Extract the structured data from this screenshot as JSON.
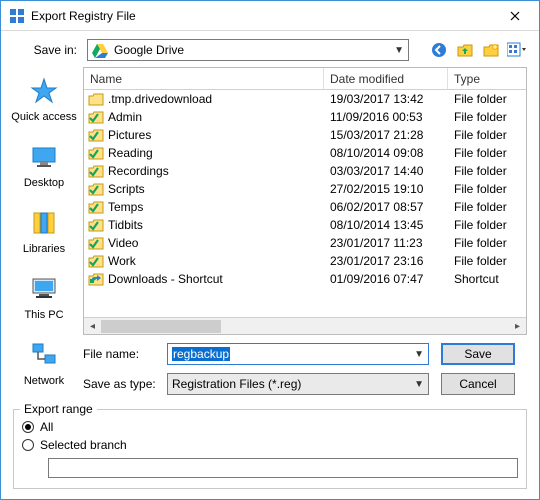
{
  "window": {
    "title": "Export Registry File"
  },
  "savein": {
    "label": "Save in:",
    "value": "Google Drive"
  },
  "places": [
    {
      "key": "quick",
      "label": "Quick access"
    },
    {
      "key": "desktop",
      "label": "Desktop"
    },
    {
      "key": "libraries",
      "label": "Libraries"
    },
    {
      "key": "thispc",
      "label": "This PC"
    },
    {
      "key": "network",
      "label": "Network"
    }
  ],
  "columns": {
    "name": "Name",
    "date": "Date modified",
    "type": "Type"
  },
  "files": [
    {
      "name": ".tmp.drivedownload",
      "date": "19/03/2017 13:42",
      "type": "File folder",
      "icon": "folder"
    },
    {
      "name": "Admin",
      "date": "11/09/2016 00:53",
      "type": "File folder",
      "icon": "folder-check"
    },
    {
      "name": "Pictures",
      "date": "15/03/2017 21:28",
      "type": "File folder",
      "icon": "folder-check"
    },
    {
      "name": "Reading",
      "date": "08/10/2014 09:08",
      "type": "File folder",
      "icon": "folder-check"
    },
    {
      "name": "Recordings",
      "date": "03/03/2017 14:40",
      "type": "File folder",
      "icon": "folder-check"
    },
    {
      "name": "Scripts",
      "date": "27/02/2015 19:10",
      "type": "File folder",
      "icon": "folder-check"
    },
    {
      "name": "Temps",
      "date": "06/02/2017 08:57",
      "type": "File folder",
      "icon": "folder-check"
    },
    {
      "name": "Tidbits",
      "date": "08/10/2014 13:45",
      "type": "File folder",
      "icon": "folder-check"
    },
    {
      "name": "Video",
      "date": "23/01/2017 11:23",
      "type": "File folder",
      "icon": "folder-check"
    },
    {
      "name": "Work",
      "date": "23/01/2017 23:16",
      "type": "File folder",
      "icon": "folder-check"
    },
    {
      "name": "Downloads - Shortcut",
      "date": "01/09/2016 07:47",
      "type": "Shortcut",
      "icon": "shortcut"
    }
  ],
  "filename": {
    "label": "File name:",
    "value": "regbackup"
  },
  "savetype": {
    "label": "Save as type:",
    "value": "Registration Files (*.reg)"
  },
  "buttons": {
    "save": "Save",
    "cancel": "Cancel"
  },
  "export": {
    "legend": "Export range",
    "all": "All",
    "selected": "Selected branch",
    "branch_value": ""
  }
}
